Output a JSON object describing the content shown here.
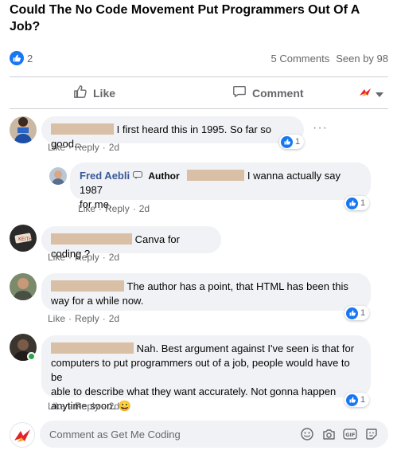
{
  "post": {
    "title": "Could The No Code Movement Put Programmers Out Of A Job?",
    "like_count": "2",
    "comments_count": "5 Comments",
    "seen_by": "Seen by 98"
  },
  "actions": {
    "like": "Like",
    "comment": "Comment"
  },
  "comments": [
    {
      "text": "I first heard this in 1995. So far so good...",
      "like": "Like",
      "reply": "Reply",
      "time": "2d",
      "reactions": "1"
    },
    {
      "author": "Fred Aebli",
      "badge": "Author",
      "text_line1": "I wanna actually say 1987",
      "text_line2": "for me.",
      "like": "Like",
      "reply": "Reply",
      "time": "2d",
      "reactions": "1"
    },
    {
      "text": "Canva for coding ?",
      "like": "Like",
      "reply": "Reply",
      "time": "2d"
    },
    {
      "text_line1": "The author has a point, that HTML has been this",
      "text_line2": "way for a while now.",
      "like": "Like",
      "reply": "Reply",
      "time": "2d",
      "reactions": "1"
    },
    {
      "text_line1": "Nah. Best argument against I've seen is that for",
      "text_line2": "computers to put programmers out of a job, people would have to be",
      "text_line3": "able to describe what they want accurately. Not gonna happen",
      "text_line4": "anytime soon.",
      "emoji": "😀",
      "like": "Like",
      "reply": "Reply",
      "time": "2d",
      "reactions": "1"
    }
  ],
  "composer": {
    "placeholder": "Comment as Get Me Coding"
  },
  "colors": {
    "accent": "#1877f2",
    "link": "#385898",
    "bubble": "#f0f2f5",
    "muted": "#65676b",
    "redaction": "#d9bfa6"
  }
}
